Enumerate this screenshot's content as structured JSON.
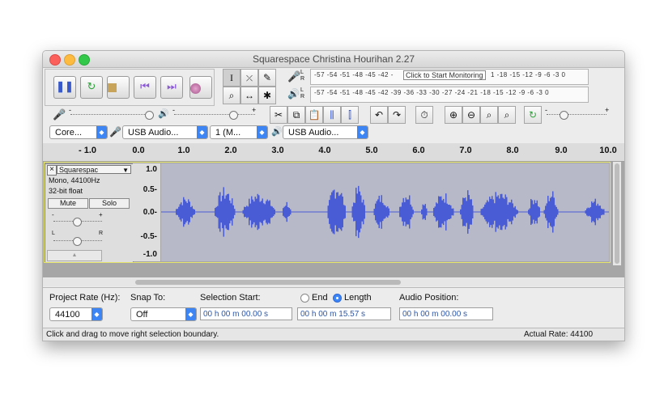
{
  "window": {
    "title": "Squarespace Christina Hourihan 2.27"
  },
  "transport": {
    "pause_icon": "pause-icon",
    "play_icon": "play-loop-icon",
    "stop_icon": "stop-icon",
    "skip_start_icon": "skip-to-start-icon",
    "skip_end_icon": "skip-to-end-icon",
    "record_icon": "record-icon"
  },
  "tools": {
    "select": "I",
    "envelope": "envelope-icon",
    "draw": "pencil-icon",
    "zoom": "zoom-icon",
    "timeshift": "↔",
    "multi": "✱"
  },
  "meters": {
    "record_label": "L\nR",
    "record_ticks": [
      "-57",
      "-54",
      "-51",
      "-48",
      "-45",
      "-42",
      "-",
      "1",
      "-18",
      "-15",
      "-12",
      "-9",
      "-6",
      "-3",
      "0"
    ],
    "record_tooltip": "Click to Start Monitoring",
    "play_ticks": [
      "-57",
      "-54",
      "-51",
      "-48",
      "-45",
      "-42",
      "-39",
      "-36",
      "-33",
      "-30",
      "-27",
      "-24",
      "-21",
      "-18",
      "-15",
      "-12",
      "-9",
      "-6",
      "-3",
      "0"
    ]
  },
  "mixer": {
    "minus": "-",
    "plus": "+"
  },
  "devices": {
    "host": "Core...",
    "input": "USB Audio...",
    "channels": "1 (M...",
    "output": "USB Audio..."
  },
  "ruler": {
    "labels": [
      "- 1.0",
      "0.0",
      "1.0",
      "2.0",
      "3.0",
      "4.0",
      "5.0",
      "6.0",
      "7.0",
      "8.0",
      "9.0",
      "10.0"
    ]
  },
  "track": {
    "name": "Squarespac",
    "close": "×",
    "menu": "▼",
    "info1": "Mono, 44100Hz",
    "info2": "32-bit float",
    "mute": "Mute",
    "solo": "Solo",
    "gain_minus": "-",
    "gain_plus": "+",
    "pan_left": "L",
    "pan_right": "R",
    "collapse": "▲",
    "y_labels": [
      "1.0",
      "0.5-",
      "0.0-",
      "-0.5-",
      "-1.0"
    ]
  },
  "selection_bar": {
    "project_rate_label": "Project Rate (Hz):",
    "project_rate_value": "44100",
    "snap_label": "Snap To:",
    "snap_value": "Off",
    "selection_start_label": "Selection Start:",
    "end_label": "End",
    "length_label": "Length",
    "audio_position_label": "Audio Position:",
    "selection_start_value": "00 h 00 m 00.00 s",
    "length_value": "00 h 00 m 15.57 s",
    "audio_position_value": "00 h 00 m 00.00 s"
  },
  "status": {
    "message": "Click and drag to move right selection boundary.",
    "rate": "Actual Rate: 44100"
  },
  "colors": {
    "waveform": "#4a5bd6",
    "selection": "#e8e56c",
    "accent": "#3d84f5"
  }
}
